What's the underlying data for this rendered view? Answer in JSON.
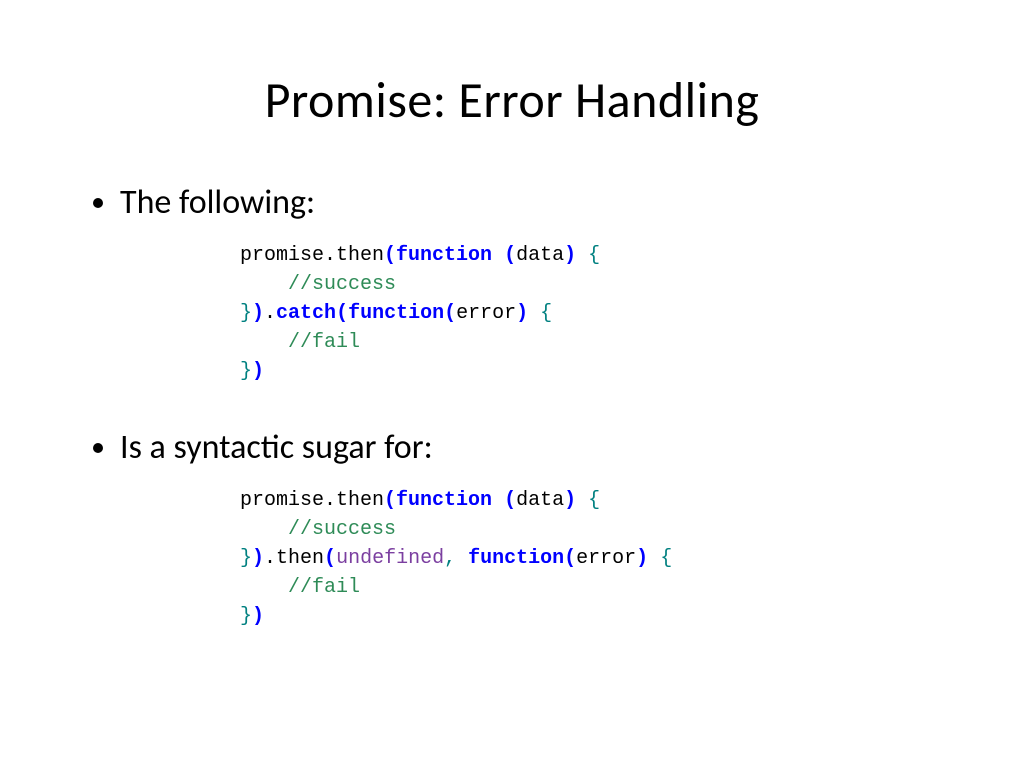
{
  "title": "Promise: Error Handling",
  "bullet1": "The following:",
  "bullet2": "Is a syntactic sugar for:",
  "code1": {
    "l1a": "promise.then",
    "l1b": "(",
    "l1c": "function ",
    "l1d": "(",
    "l1e": "data",
    "l1f": ")",
    "l1g": " {",
    "l2": "    //success",
    "l3a": "}",
    "l3b": ")",
    "l3c": ".",
    "l3d": "catch",
    "l3e": "(",
    "l3f": "function",
    "l3g": "(",
    "l3h": "error",
    "l3i": ")",
    "l3j": " {",
    "l4": "    //fail",
    "l5a": "}",
    "l5b": ")"
  },
  "code2": {
    "l1a": "promise.then",
    "l1b": "(",
    "l1c": "function ",
    "l1d": "(",
    "l1e": "data",
    "l1f": ")",
    "l1g": " {",
    "l2": "    //success",
    "l3a": "}",
    "l3b": ")",
    "l3c": ".then",
    "l3d": "(",
    "l3e": "undefined",
    "l3f": ",",
    "l3g": " function",
    "l3h": "(",
    "l3i": "error",
    "l3j": ")",
    "l3k": " {",
    "l4": "    //fail",
    "l5a": "}",
    "l5b": ")"
  }
}
